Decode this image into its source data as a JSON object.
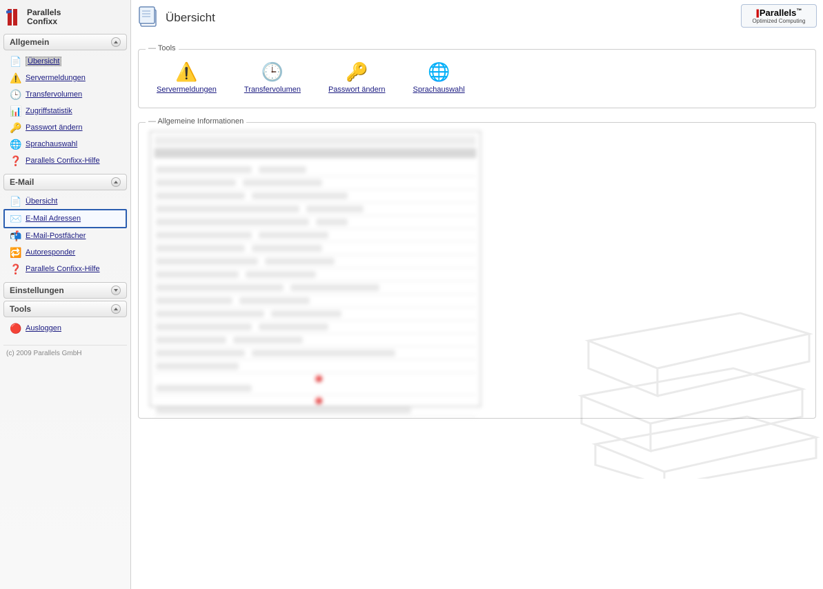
{
  "app": {
    "name_line1": "Parallels",
    "name_line2": "Confixx"
  },
  "sidebar": {
    "sections": [
      {
        "title": "Allgemein",
        "expanded": true,
        "items": [
          {
            "label": "Übersicht",
            "icon": "document-icon",
            "active": true
          },
          {
            "label": "Servermeldungen",
            "icon": "warning-icon"
          },
          {
            "label": "Transfervolumen",
            "icon": "gauge-icon"
          },
          {
            "label": "Zugriffstatistik",
            "icon": "chart-icon"
          },
          {
            "label": "Passwort ändern",
            "icon": "key-icon"
          },
          {
            "label": "Sprachauswahl",
            "icon": "globe-icon"
          },
          {
            "label": "Parallels Confixx-Hilfe",
            "icon": "help-icon"
          }
        ]
      },
      {
        "title": "E-Mail",
        "expanded": true,
        "items": [
          {
            "label": "Übersicht",
            "icon": "document-icon"
          },
          {
            "label": "E-Mail Adressen",
            "icon": "mail-icon",
            "selected": true
          },
          {
            "label": "E-Mail-Postfächer",
            "icon": "mailbox-icon"
          },
          {
            "label": "Autoresponder",
            "icon": "autoreply-icon"
          },
          {
            "label": "Parallels Confixx-Hilfe",
            "icon": "help-icon"
          }
        ]
      },
      {
        "title": "Einstellungen",
        "expanded": false
      },
      {
        "title": "Tools",
        "expanded": true,
        "items": [
          {
            "label": "Ausloggen",
            "icon": "logout-icon"
          }
        ]
      }
    ]
  },
  "copyright": "(c) 2009 Parallels GmbH",
  "main": {
    "title": "Übersicht",
    "tools_legend": "Tools",
    "info_legend": "Allgemeine Informationen",
    "tools": [
      {
        "label": "Servermeldungen",
        "icon": "warning-icon"
      },
      {
        "label": "Transfervolumen",
        "icon": "gauge-icon"
      },
      {
        "label": "Passwort ändern",
        "icon": "key-icon"
      },
      {
        "label": "Sprachauswahl",
        "icon": "globe-icon"
      }
    ]
  },
  "top_right": {
    "brand": "Parallels",
    "tagline": "Optimized Computing"
  },
  "icons": {
    "document-icon": "📄",
    "warning-icon": "⚠️",
    "gauge-icon": "🕒",
    "chart-icon": "📊",
    "key-icon": "🔑",
    "globe-icon": "🌐",
    "help-icon": "❓",
    "mail-icon": "✉️",
    "mailbox-icon": "📬",
    "autoreply-icon": "🔁",
    "logout-icon": "🔴"
  }
}
